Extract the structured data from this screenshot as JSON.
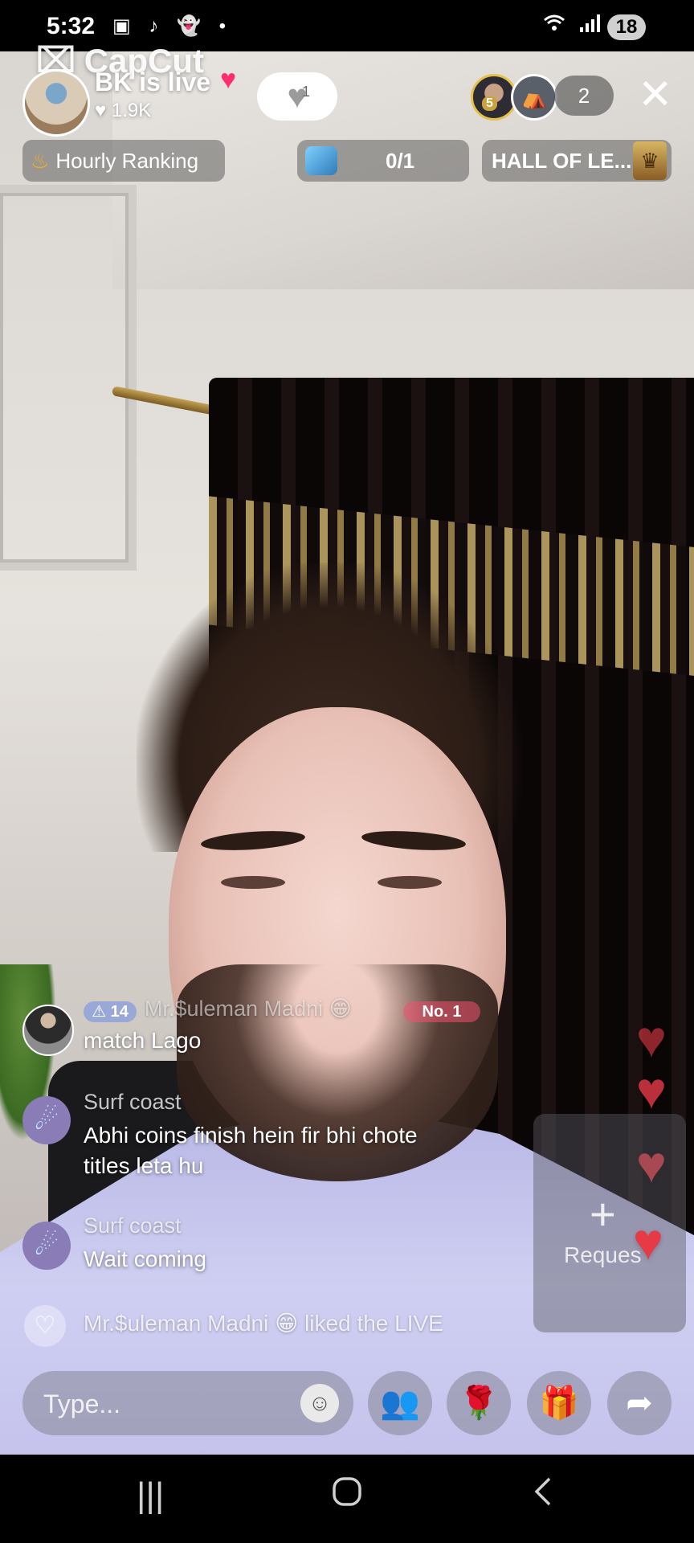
{
  "status_bar": {
    "time": "5:32",
    "notif_icons": "▣ ♪ 👻 •",
    "battery": "18"
  },
  "watermark": {
    "text": "CapCut"
  },
  "header": {
    "title": "BK is live",
    "likes": "♥ 1.9K",
    "follow_count": "1",
    "viewer_badge": "5",
    "viewer_count": "2",
    "close_glyph": "✕"
  },
  "ranking": {
    "hourly_label": "Hourly Ranking",
    "goal_progress": "0/1",
    "hall_label": "HALL OF LE..."
  },
  "chat": [
    {
      "level": "14",
      "name": "Mr.$uleman Madni 😁",
      "rank_badge": "No. 1",
      "message": "match Lago"
    },
    {
      "name": "Surf coast",
      "message_line1": "Abhi coins finish hein fir bhi chote",
      "message_line2": "titles leta hu"
    },
    {
      "name": "Surf coast",
      "message": "Wait coming"
    }
  ],
  "like_event": "Mr.$uleman Madni 😁 liked the LIVE",
  "request_panel": {
    "label": "Reques"
  },
  "bottom_bar": {
    "input_placeholder": "Type..."
  },
  "colors": {
    "heart": "#e63a46",
    "rank_fire": "#f6b30b",
    "people_icon": "#29d3d6",
    "gift_icon": "#ff3d8a"
  },
  "icons": {
    "emoji": "emoji-icon",
    "people": "people-icon",
    "rose": "rose-icon",
    "gift": "gift-icon",
    "share": "share-icon",
    "nav_recents": "recents-icon",
    "nav_home": "home-icon",
    "nav_back": "back-icon"
  }
}
